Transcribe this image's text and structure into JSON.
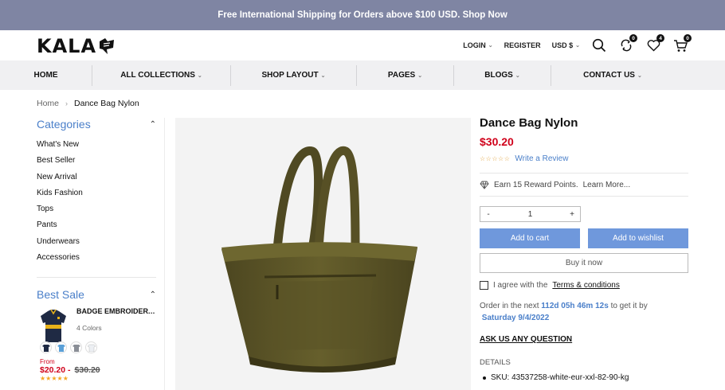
{
  "announcement": "Free International Shipping for Orders above $100 USD. Shop Now",
  "header": {
    "logo": "KALA",
    "login": "LOGIN",
    "register": "REGISTER",
    "currency": "USD $",
    "compare_count": "0",
    "wishlist_count": "4",
    "cart_count": "0"
  },
  "nav": {
    "items": [
      "HOME",
      "ALL COLLECTIONS",
      "SHOP LAYOUT",
      "PAGES",
      "BLOGS",
      "CONTACT US"
    ]
  },
  "breadcrumb": {
    "home": "Home",
    "current": "Dance Bag Nylon"
  },
  "sidebar": {
    "categories_title": "Categories",
    "categories": [
      "What's New",
      "Best Seller",
      "New Arrival",
      "Kids Fashion",
      "Tops",
      "Pants",
      "Underwears",
      "Accessories"
    ],
    "best_sale_title": "Best Sale",
    "best_sale_item": {
      "name": "BADGE EMBROIDERY POLO SHIRT",
      "colors": "4 Colors",
      "from": "From",
      "price": "$20.20 -",
      "old_price": "$30.20",
      "stars": "★★★★★"
    }
  },
  "product": {
    "title": "Dance Bag Nylon",
    "price": "$30.20",
    "stars": "☆☆☆☆☆",
    "write_review": "Write a Review",
    "reward": "Earn 15 Reward Points.",
    "learn_more": "Learn More...",
    "qty_minus": "-",
    "qty": "1",
    "qty_plus": "+",
    "add_to_cart": "Add to cart",
    "add_to_wishlist": "Add to wishlist",
    "buy_now": "Buy it now",
    "agree_text": "I agree with the",
    "terms": "Terms & conditions",
    "order_prefix": "Order in the next",
    "countdown": "112d 05h 46m 12s",
    "order_mid": "to get it by",
    "delivery_date": "Saturday 9/4/2022",
    "ask": "ASK US ANY QUESTION",
    "details": "DETAILS",
    "sku": "SKU: 43537258-white-eur-xxl-82-90-kg"
  },
  "colors": {
    "topbar": "#7f85a3",
    "accent": "#4a7fc9",
    "price": "#d0021b",
    "button": "#6f98dc",
    "bag": "#5a5427"
  }
}
